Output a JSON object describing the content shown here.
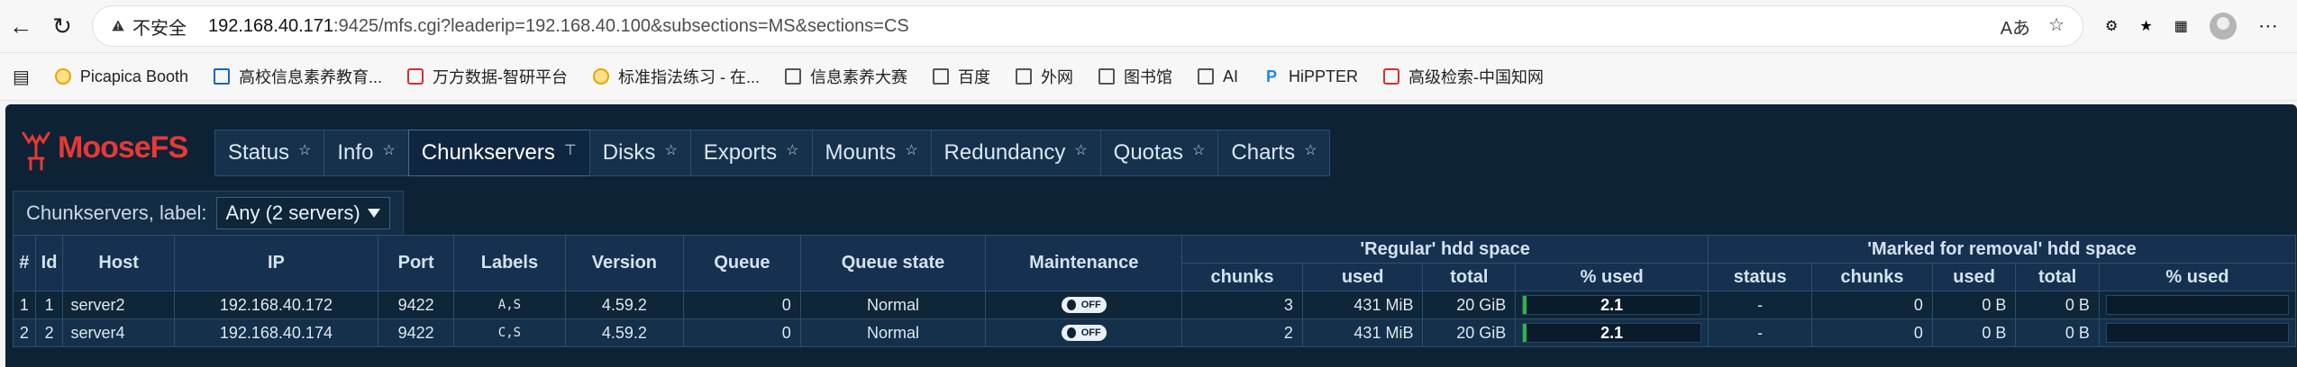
{
  "browser": {
    "url_host": "192.168.40.171",
    "url_rest": ":9425/mfs.cgi?leaderip=192.168.40.100&subsections=MS&sections=CS",
    "insecure_label": "不安全",
    "address_right_text": "Aあ"
  },
  "bookmarks": [
    {
      "label": "Picapica Booth",
      "icon": "picapica-icon"
    },
    {
      "label": "高校信息素养教育...",
      "icon": "z-logo-icon"
    },
    {
      "label": "万方数据-智研平台",
      "icon": "wanfang-icon"
    },
    {
      "label": "标准指法练习 - 在...",
      "icon": "emoji-icon"
    },
    {
      "label": "信息素养大赛",
      "icon": "folder-icon"
    },
    {
      "label": "百度",
      "icon": "folder-icon"
    },
    {
      "label": "外网",
      "icon": "folder-icon"
    },
    {
      "label": "图书馆",
      "icon": "folder-icon"
    },
    {
      "label": "AI",
      "icon": "folder-icon"
    },
    {
      "label": "HiPPTER",
      "icon": "p-logo-icon"
    },
    {
      "label": "高级检索-中国知网",
      "icon": "cnki-icon"
    }
  ],
  "app": {
    "logo": "MooseFS",
    "tabs": [
      {
        "label": "Status",
        "active": false
      },
      {
        "label": "Info",
        "active": false
      },
      {
        "label": "Chunkservers",
        "active": true
      },
      {
        "label": "Disks",
        "active": false
      },
      {
        "label": "Exports",
        "active": false
      },
      {
        "label": "Mounts",
        "active": false
      },
      {
        "label": "Redundancy",
        "active": false
      },
      {
        "label": "Quotas",
        "active": false
      },
      {
        "label": "Charts",
        "active": false
      }
    ],
    "filter": {
      "label": "Chunkservers, label:",
      "value": "Any (2 servers)"
    },
    "table": {
      "group_regular": "'Regular' hdd space",
      "group_removal": "'Marked for removal' hdd space",
      "headers": {
        "hash": "#",
        "id": "Id",
        "host": "Host",
        "ip": "IP",
        "port": "Port",
        "labels": "Labels",
        "version": "Version",
        "queue": "Queue",
        "queue_state": "Queue state",
        "maintenance": "Maintenance",
        "chunks": "chunks",
        "used": "used",
        "total": "total",
        "pct_used": "% used",
        "status": "status",
        "chunks2": "chunks",
        "used2": "used",
        "total2": "total",
        "pct_used2": "% used"
      },
      "rows": [
        {
          "num": "1",
          "id": "1",
          "host": "server2",
          "ip": "192.168.40.172",
          "port": "9422",
          "labels": "A,S",
          "version": "4.59.2",
          "queue": "0",
          "queue_state": "Normal",
          "maintenance": "OFF",
          "chunks": "3",
          "used": "431 MiB",
          "total": "20 GiB",
          "pct": "2.1",
          "status": "-",
          "chunks2": "0",
          "used2": "0 B",
          "total2": "0 B",
          "pct2": ""
        },
        {
          "num": "2",
          "id": "2",
          "host": "server4",
          "ip": "192.168.40.174",
          "port": "9422",
          "labels": "C,S",
          "version": "4.59.2",
          "queue": "0",
          "queue_state": "Normal",
          "maintenance": "OFF",
          "chunks": "2",
          "used": "431 MiB",
          "total": "20 GiB",
          "pct": "2.1",
          "status": "-",
          "chunks2": "0",
          "used2": "0 B",
          "total2": "0 B",
          "pct2": ""
        }
      ]
    }
  },
  "colors": {
    "app_bg": "#0e2235",
    "tab_bg": "#16314b",
    "accent_red": "#e53935",
    "usage_fill": "#2fb34a"
  }
}
